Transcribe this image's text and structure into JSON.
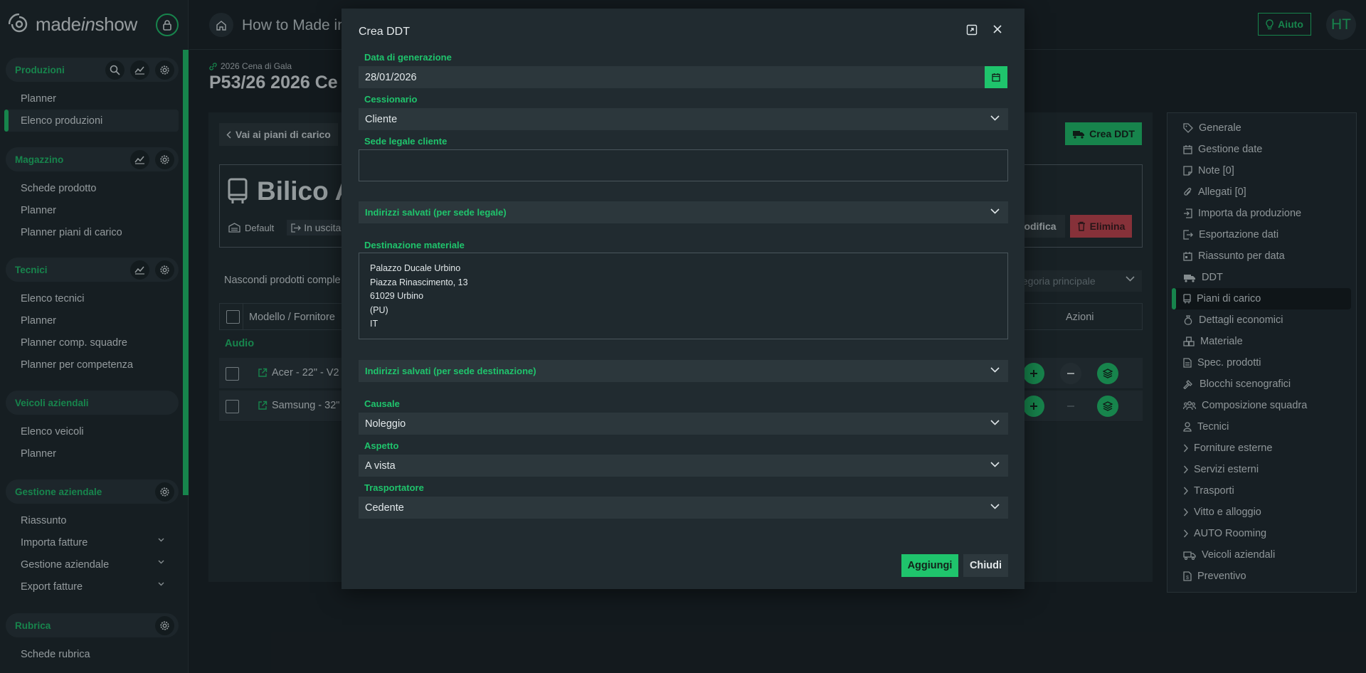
{
  "brand": {
    "name_part1": "made",
    "name_part2": "in",
    "name_part3": "show"
  },
  "sidebar": {
    "sections": [
      {
        "title": "Produzioni",
        "items": [
          "Planner",
          "Elenco produzioni"
        ]
      },
      {
        "title": "Magazzino",
        "items": [
          "Schede prodotto",
          "Planner",
          "Planner piani di carico"
        ]
      },
      {
        "title": "Tecnici",
        "items": [
          "Elenco tecnici",
          "Planner",
          "Planner comp. squadre",
          "Planner per competenza"
        ]
      },
      {
        "title": "Veicoli aziendali",
        "items": [
          "Elenco veicoli",
          "Planner"
        ]
      },
      {
        "title": "Gestione aziendale",
        "items": [
          "Riassunto",
          "Importa fatture",
          "Gestione aziendale",
          "Export fatture"
        ]
      },
      {
        "title": "Rubrica",
        "items": [
          "Schede rubrica"
        ]
      }
    ]
  },
  "topbar": {
    "title": "How to Made in",
    "help_label": "Aiuto",
    "avatar_initials": "HT"
  },
  "main": {
    "breadcrumb": "2026 Cena di Gala",
    "title": "P53/26 2026 Ce",
    "back_label": "Vai ai piani di carico",
    "crea_ddt_label": "Crea DDT",
    "card_title": "Bilico A",
    "card_default": "Default",
    "card_status": "In uscita",
    "modifica_label": "odifica",
    "elimina_label": "Elimina",
    "hide_text": "Nascondi prodotti comple",
    "category_placeholder": "tegoria principale",
    "table": {
      "col_model": "Modello / Fornitore",
      "col_actions": "Azioni",
      "group": "Audio",
      "rows": [
        "Acer - 22\" - V2",
        "Samsung - 32\""
      ]
    }
  },
  "right_nav": {
    "items": [
      "Generale",
      "Gestione date",
      "Note [0]",
      "Allegati [0]",
      "Importa da produzione",
      "Esportazione dati",
      "Riassunto per data",
      "DDT",
      "Piani di carico",
      "Dettagli economici",
      "Materiale",
      "Spec. prodotti",
      "Blocchi scenografici",
      "Composizione squadra",
      "Tecnici",
      "Forniture esterne",
      "Servizi esterni",
      "Trasporti",
      "Vitto e alloggio",
      "AUTO Rooming",
      "Veicoli aziendali",
      "Preventivo"
    ]
  },
  "modal": {
    "title": "Crea DDT",
    "data_label": "Data di generazione",
    "data_value": "28/01/2026",
    "cessionario_label": "Cessionario",
    "cessionario_value": "Cliente",
    "sede_label": "Sede legale cliente",
    "indirizzi_legale": "Indirizzi salvati (per sede legale)",
    "destinazione_label": "Destinazione materiale",
    "destinazione_lines": [
      "Palazzo Ducale Urbino",
      "Piazza Rinascimento, 13",
      "61029 Urbino",
      "(PU)",
      "IT"
    ],
    "indirizzi_dest": "Indirizzi salvati (per sede destinazione)",
    "causale_label": "Causale",
    "causale_value": "Noleggio",
    "aspetto_label": "Aspetto",
    "aspetto_value": "A vista",
    "trasportatore_label": "Trasportatore",
    "trasportatore_value": "Cedente",
    "add_label": "Aggiungi",
    "close_label": "Chiudi"
  },
  "colors": {
    "accent": "#1fc46c",
    "danger": "#c9444f",
    "background": "#1a2125"
  }
}
